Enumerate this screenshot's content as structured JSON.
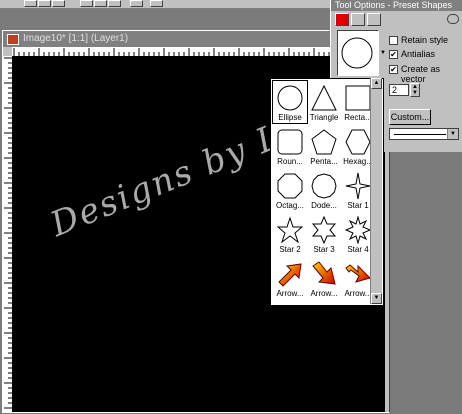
{
  "document": {
    "title": "Image10* [1:1] (Layer1)"
  },
  "tool_options": {
    "title": "Tool Options - Preset Shapes",
    "retain_style_label": "Retain style",
    "retain_style_checked": false,
    "antialias_label": "Antialias",
    "antialias_checked": true,
    "create_vector_label": "Create as vector",
    "create_vector_checked": true,
    "line_width_value": "2",
    "custom_button_label": "Custom...",
    "check_mark": "✔"
  },
  "shapes_list": {
    "items": [
      {
        "label": "Ellipse",
        "icon": "ellipse-icon"
      },
      {
        "label": "Triangle",
        "icon": "triangle-icon"
      },
      {
        "label": "Recta...",
        "icon": "rectangle-icon"
      },
      {
        "label": "Roun...",
        "icon": "rounded-rectangle-icon"
      },
      {
        "label": "Penta...",
        "icon": "pentagon-icon"
      },
      {
        "label": "Hexag...",
        "icon": "hexagon-icon"
      },
      {
        "label": "Octag...",
        "icon": "octagon-icon"
      },
      {
        "label": "Dode...",
        "icon": "dodecagon-icon"
      },
      {
        "label": "Star 1",
        "icon": "star1-icon"
      },
      {
        "label": "Star 2",
        "icon": "star2-icon"
      },
      {
        "label": "Star 3",
        "icon": "star3-icon"
      },
      {
        "label": "Star 4",
        "icon": "star4-icon"
      },
      {
        "label": "Arrow...",
        "icon": "arrow-icon"
      },
      {
        "label": "Arrow...",
        "icon": "arrow-icon"
      },
      {
        "label": "Arrow...",
        "icon": "arrow-icon"
      }
    ]
  },
  "watermark": {
    "text": "Designs by Linda"
  },
  "colors": {
    "canvas": "#000000",
    "workspace": "#7b7b7b",
    "panel": "#c0c0c0",
    "titlebar": "#808080"
  }
}
